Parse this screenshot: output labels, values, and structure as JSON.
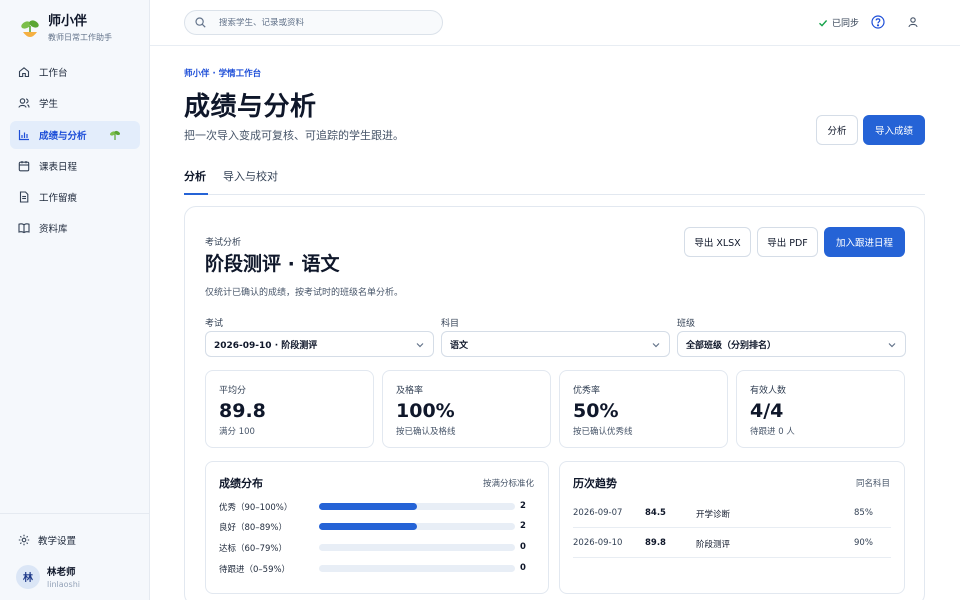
{
  "app": {
    "name": "师小伴",
    "tagline": "教师日常工作助手"
  },
  "sidebar": {
    "items": [
      {
        "label": "工作台",
        "icon": "home-icon"
      },
      {
        "label": "学生",
        "icon": "users-icon"
      },
      {
        "label": "成绩与分析",
        "icon": "bar-chart-icon",
        "active": true
      },
      {
        "label": "课表日程",
        "icon": "calendar-icon"
      },
      {
        "label": "工作留痕",
        "icon": "document-icon"
      },
      {
        "label": "资料库",
        "icon": "book-icon"
      }
    ],
    "settings_label": "教学设置",
    "user": {
      "avatar": "林",
      "name": "林老师",
      "id": "linlaoshi"
    }
  },
  "topbar": {
    "search_placeholder": "搜索学生、记录或资料",
    "sync_label": "已同步"
  },
  "page": {
    "breadcrumb": "师小伴 · 学情工作台",
    "title": "成绩与分析",
    "subtitle": "把一次导入变成可复核、可追踪的学生跟进。",
    "analyze_button": "分析",
    "import_button": "导入成绩",
    "tabs": [
      {
        "label": "分析",
        "active": true
      },
      {
        "label": "导入与校对"
      }
    ]
  },
  "exam": {
    "eyebrow": "考试分析",
    "title": "阶段测评 · 语文",
    "note": "仅统计已确认的成绩，按考试时的班级名单分析。",
    "export_xlsx": "导出 XLSX",
    "export_pdf": "导出 PDF",
    "add_followup": "加入跟进日程",
    "filters": [
      {
        "label": "考试",
        "value": "2026-09-10 · 阶段测评"
      },
      {
        "label": "科目",
        "value": "语文"
      },
      {
        "label": "班级",
        "value": "全部班级（分别排名）"
      }
    ]
  },
  "stats": [
    {
      "label": "平均分",
      "value": "89.8",
      "note": "满分 100"
    },
    {
      "label": "及格率",
      "value": "100%",
      "note": "按已确认及格线"
    },
    {
      "label": "优秀率",
      "value": "50%",
      "note": "按已确认优秀线"
    },
    {
      "label": "有效人数",
      "value": "4/4",
      "note": "待跟进 0 人"
    }
  ],
  "distribution": {
    "title": "成绩分布",
    "meta": "按满分标准化",
    "rows": [
      {
        "label": "优秀（90–100%）",
        "count": "2",
        "share": 0.5
      },
      {
        "label": "良好（80–89%）",
        "count": "2",
        "share": 0.5
      },
      {
        "label": "达标（60–79%）",
        "count": "0",
        "share": 0
      },
      {
        "label": "待跟进（0–59%）",
        "count": "0",
        "share": 0
      }
    ],
    "accent": "#2563d6"
  },
  "trend": {
    "title": "历次趋势",
    "meta": "同名科目",
    "rows": [
      {
        "date": "2026-09-07",
        "score": "84.5",
        "name": "开学诊断",
        "rate": "85%"
      },
      {
        "date": "2026-09-10",
        "score": "89.8",
        "name": "阶段测评",
        "rate": "90%"
      }
    ]
  }
}
